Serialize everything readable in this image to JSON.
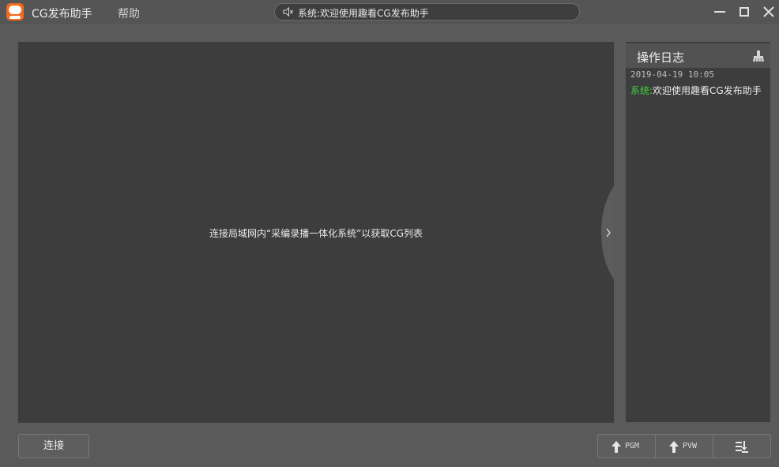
{
  "app": {
    "title": "CG发布助手",
    "menu_help": "帮助"
  },
  "notice": {
    "icon": "speaker-icon",
    "text": "系统:欢迎使用趣看CG发布助手"
  },
  "window_controls": [
    "minimize-icon",
    "maximize-icon",
    "close-icon"
  ],
  "main": {
    "hint": "连接局域网内“采编录播一体化系统”以获取CG列表"
  },
  "log": {
    "title": "操作日志",
    "clear_icon": "broom-icon",
    "entries": [
      {
        "time": "2019-04-19 10:05",
        "source": "系统:",
        "message": "欢迎使用趣看CG发布助手"
      }
    ]
  },
  "bottom": {
    "connect_label": "连接",
    "pgm_label": "PGM",
    "pvw_label": "PVW",
    "list_icon": "sort-down-icon"
  },
  "colors": {
    "accent_orange": "#f26a1b",
    "log_source_green": "#3fd13f",
    "panel_bg": "#3d3d3d",
    "window_bg": "#5a5a5a"
  }
}
